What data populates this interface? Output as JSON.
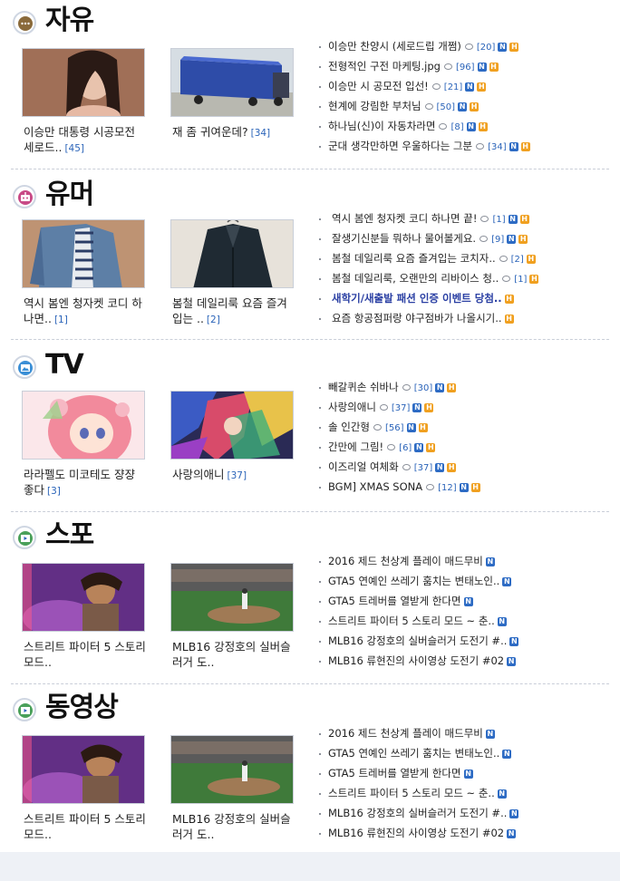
{
  "sections": [
    {
      "title": "자유",
      "icon": "speech-bubble-icon",
      "thumbs": [
        {
          "caption": "이승만 대통령 시공모전 세로드..",
          "count": "[45]",
          "image": "woman-portrait-photo"
        },
        {
          "caption": "재 좀 귀여운데?",
          "count": "[34]",
          "image": "blue-truck-photo"
        }
      ],
      "list": [
        {
          "text": "이승만 찬양시 (세로드립 개쩜)",
          "comments": "[20]",
          "badges": [
            "N",
            "H"
          ]
        },
        {
          "text": "전형적인 구전 마케팅.jpg",
          "comments": "[96]",
          "badges": [
            "N",
            "H"
          ]
        },
        {
          "text": "이승만 시 공모전 입선!",
          "comments": "[21]",
          "badges": [
            "N",
            "H"
          ]
        },
        {
          "text": "현계에 강림한 부처님",
          "comments": "[50]",
          "badges": [
            "N",
            "H"
          ]
        },
        {
          "text": "하나님(신)이 자동차라면",
          "comments": "[8]",
          "badges": [
            "N",
            "H"
          ]
        },
        {
          "text": "군대 생각만하면 우울하다는 그분",
          "comments": "[34]",
          "badges": [
            "N",
            "H"
          ]
        }
      ]
    },
    {
      "title": "유머",
      "icon": "robot-icon",
      "thumbs": [
        {
          "caption": "역시 봄엔 청자켓 코디 하나면..",
          "count": "[1]",
          "image": "denim-jacket-photo"
        },
        {
          "caption": "봄철 데일리룩 요즘 즐겨입는 ..",
          "count": "[2]",
          "image": "dark-jacket-photo"
        }
      ],
      "list": [
        {
          "text": "역시 봄엔 청자켓 코디 하나면 끝!",
          "comments": "[1]",
          "badges": [
            "N",
            "H"
          ]
        },
        {
          "text": "잘생기신분들 뭐하나 물어볼게요.",
          "comments": "[9]",
          "badges": [
            "N",
            "H"
          ]
        },
        {
          "text": "봄철 데일리룩 요즘 즐겨입는 코치자..",
          "comments": "[2]",
          "badges": [
            "H"
          ]
        },
        {
          "text": "봄철 데일리룩, 오랜만의 리바이스 청..",
          "comments": "[1]",
          "badges": [
            "H"
          ]
        },
        {
          "text": "새학기/새출발 패션 인증 이벤트 당첨..",
          "comments": "",
          "badges": [
            "H"
          ],
          "bold": true
        },
        {
          "text": "요즘 항공점퍼랑 야구점바가 나올시기..",
          "comments": "",
          "badges": [
            "H"
          ]
        }
      ]
    },
    {
      "title": "TV",
      "icon": "picture-icon",
      "thumbs": [
        {
          "caption": "라라펠도 미코테도 쟝쟝 좋다",
          "count": "[3]",
          "image": "anime-girl-image"
        },
        {
          "caption": "사랑의애니",
          "count": "[37]",
          "image": "colorful-anime-image"
        }
      ],
      "list": [
        {
          "text": "빼갈퀴손 쉬바나",
          "comments": "[30]",
          "badges": [
            "N",
            "H"
          ]
        },
        {
          "text": "사랑의애니",
          "comments": "[37]",
          "badges": [
            "N",
            "H"
          ]
        },
        {
          "text": "솔 인간형",
          "comments": "[56]",
          "badges": [
            "N",
            "H"
          ]
        },
        {
          "text": "간만에 그림!",
          "comments": "[6]",
          "badges": [
            "N",
            "H"
          ]
        },
        {
          "text": "이즈리얼 여체화",
          "comments": "[37]",
          "badges": [
            "N",
            "H"
          ]
        },
        {
          "text": "BGM] XMAS SONA",
          "comments": "[12]",
          "badges": [
            "N",
            "H"
          ]
        }
      ]
    },
    {
      "title": "스포",
      "icon": "video-icon",
      "thumbs": [
        {
          "caption": "스트리트 파이터 5 스토리 모드..",
          "count": "",
          "image": "fighting-game-screenshot"
        },
        {
          "caption": "MLB16 강정호의 실버슬러거 도..",
          "count": "",
          "image": "baseball-game-screenshot"
        }
      ],
      "list": [
        {
          "text": "2016 제드 천상계 플레이 매드무비",
          "comments": "",
          "badges": [
            "N"
          ]
        },
        {
          "text": "GTA5 연예인 쓰레기 훔치는 변태노인..",
          "comments": "",
          "badges": [
            "N"
          ]
        },
        {
          "text": "GTA5 트레버를 열받게 한다면",
          "comments": "",
          "badges": [
            "N"
          ]
        },
        {
          "text": "스트리트 파이터 5 스토리 모드 ~ 춘..",
          "comments": "",
          "badges": [
            "N"
          ]
        },
        {
          "text": "MLB16 강정호의 실버슬러거 도전기 #..",
          "comments": "",
          "badges": [
            "N"
          ]
        },
        {
          "text": "MLB16 류현진의 사이영상 도전기 #02",
          "comments": "",
          "badges": [
            "N"
          ]
        }
      ]
    },
    {
      "title": "동영상",
      "icon": "video-icon",
      "thumbs": [
        {
          "caption": "스트리트 파이터 5 스토리 모드..",
          "count": "",
          "image": "fighting-game-screenshot"
        },
        {
          "caption": "MLB16 강정호의 실버슬러거 도..",
          "count": "",
          "image": "baseball-game-screenshot"
        }
      ],
      "list": [
        {
          "text": "2016 제드 천상계 플레이 매드무비",
          "comments": "",
          "badges": [
            "N"
          ]
        },
        {
          "text": "GTA5 연예인 쓰레기 훔치는 변태노인..",
          "comments": "",
          "badges": [
            "N"
          ]
        },
        {
          "text": "GTA5 트레버를 열받게 한다면",
          "comments": "",
          "badges": [
            "N"
          ]
        },
        {
          "text": "스트리트 파이터 5 스토리 모드 ~ 춘..",
          "comments": "",
          "badges": [
            "N"
          ]
        },
        {
          "text": "MLB16 강정호의 실버슬러거 도전기 #..",
          "comments": "",
          "badges": [
            "N"
          ]
        },
        {
          "text": "MLB16 류현진의 사이영상 도전기 #02",
          "comments": "",
          "badges": [
            "N"
          ]
        }
      ]
    }
  ]
}
